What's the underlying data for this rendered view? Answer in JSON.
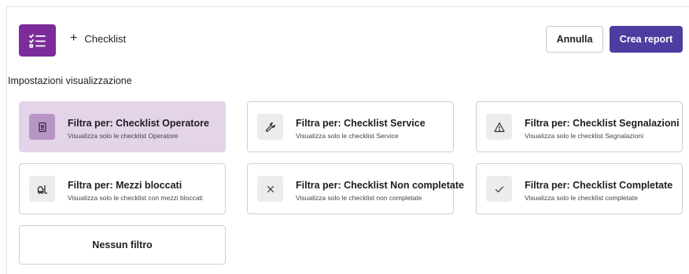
{
  "header": {
    "app_icon": "checklist-icon",
    "add_label": "Checklist",
    "cancel_label": "Annulla",
    "create_label": "Crea report"
  },
  "section": {
    "title": "Impostazioni visualizzazione"
  },
  "filters": [
    {
      "title": "Filtra per: Checklist Operatore",
      "subtitle": "Visualizza solo le checklist Operatore",
      "icon": "badge-icon",
      "selected": true
    },
    {
      "title": "Filtra per: Checklist Service",
      "subtitle": "Visualizza solo le checklist Service",
      "icon": "wrench-icon",
      "selected": false
    },
    {
      "title": "Filtra per: Checklist Segnalazioni",
      "subtitle": "Visualizza solo le checklist Segnalazioni",
      "icon": "warning-icon",
      "selected": false
    },
    {
      "title": "Filtra per: Mezzi bloccati",
      "subtitle": "Visualizza solo le checklist con mezzi bloccati",
      "icon": "forklift-icon",
      "selected": false
    },
    {
      "title": "Filtra per: Checklist Non completate",
      "subtitle": "Visualizza solo le checklist non completate",
      "icon": "close-icon",
      "selected": false
    },
    {
      "title": "Filtra per: Checklist Completate",
      "subtitle": "Visualizza solo le checklist completate",
      "icon": "check-icon",
      "selected": false
    }
  ],
  "no_filter_label": "Nessun filtro",
  "colors": {
    "brand": "#7c2c9a",
    "primary_button": "#4c3ea0",
    "selected_card": "#e3d4ea"
  }
}
